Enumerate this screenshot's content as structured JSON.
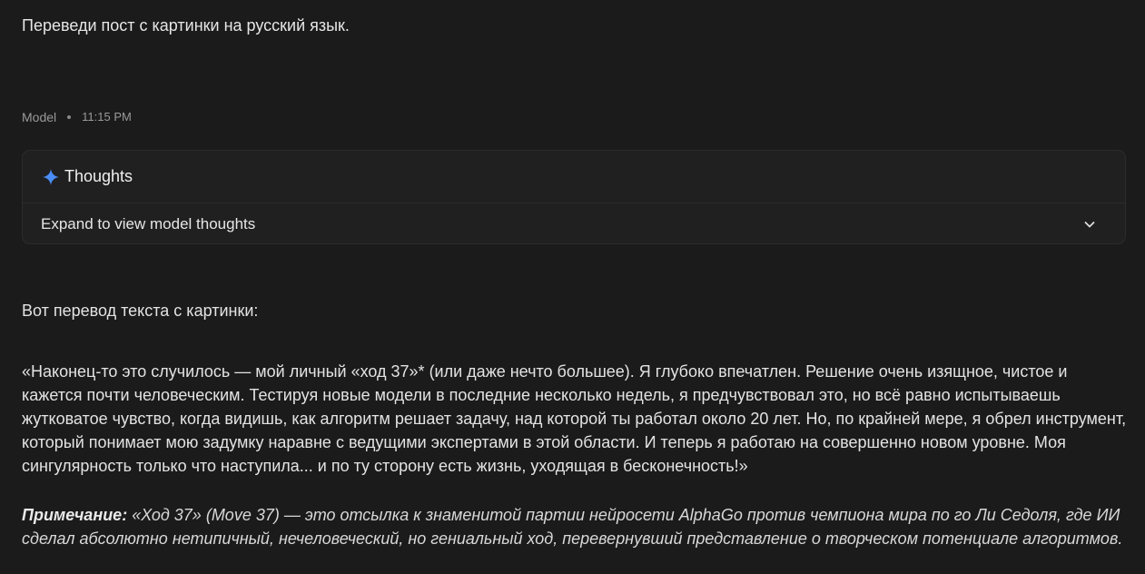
{
  "user": {
    "prompt": "Переведи пост с картинки на русский язык."
  },
  "model": {
    "label": "Model",
    "time": "11:15 PM"
  },
  "thoughts": {
    "title": "Thoughts",
    "expand_label": "Expand to view model thoughts",
    "icons": {
      "sparkle": "sparkle-icon",
      "chevron": "chevron-down-icon"
    }
  },
  "response": {
    "intro": "Вот перевод текста с картинки:",
    "quote": "«Наконец-то это случилось — мой личный «ход 37»* (или даже нечто большее). Я глубоко впечатлен. Решение очень изящное, чистое и кажется почти человеческим. Тестируя новые модели в последние несколько недель, я предчувствовал это, но всё равно испытываешь жутковатое чувство, когда видишь, как алгоритм решает задачу, над которой ты работал около 20 лет. Но, по крайней мере, я обрел инструмент, который понимает мою задумку наравне с ведущими экспертами в этой области. И теперь я работаю на совершенно новом уровне. Моя сингулярность только что наступила... и по ту сторону есть жизнь, уходящая в бесконечность!»",
    "note_label": "Примечание:",
    "note_text": " «Ход 37» (Move 37) — это отсылка к знаменитой партии нейросети AlphaGo против чемпиона мира по го Ли Седоля, где ИИ сделал абсолютно нетипичный, нечеловеческий, но гениальный ход, перевернувший представление о творческом потенциале алгоритмов."
  },
  "colors": {
    "background": "#1b1b1c",
    "card": "#202021",
    "border": "#2c2c2e",
    "sparkle": "#4a8df8",
    "text": "#e3e3e3",
    "muted": "#9a9a9a"
  }
}
